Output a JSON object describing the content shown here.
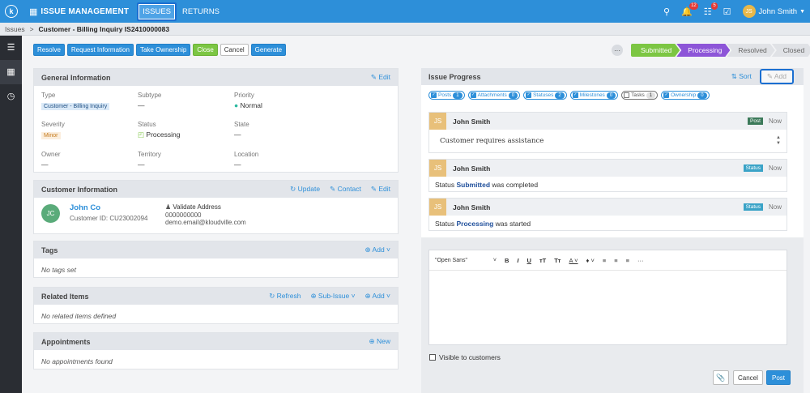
{
  "topnav": {
    "logo": "k",
    "app_title": "ISSUE MANAGEMENT",
    "tabs": [
      {
        "label": "ISSUES"
      },
      {
        "label": "RETURNS"
      }
    ],
    "notif_count": "12",
    "tasks_count": "5",
    "user_initials": "JS",
    "user_name": "John Smith"
  },
  "breadcrumb": {
    "root": "Issues",
    "current": "Customer - Billing Inquiry IS2410000083"
  },
  "toolbar": {
    "resolve": "Resolve",
    "request_info": "Request Information",
    "take_ownership": "Take Ownership",
    "close": "Close",
    "cancel": "Cancel",
    "generate": "Generate"
  },
  "stages": [
    {
      "label": "Submitted"
    },
    {
      "label": "Processing"
    },
    {
      "label": "Resolved"
    },
    {
      "label": "Closed"
    }
  ],
  "general": {
    "title": "General Information",
    "edit": "Edit",
    "type_label": "Type",
    "type_value": "Customer - Billing Inquiry",
    "subtype_label": "Subtype",
    "subtype_value": "—",
    "priority_label": "Priority",
    "priority_value": "Normal",
    "severity_label": "Severity",
    "severity_value": "Minor",
    "status_label": "Status",
    "status_value": "Processing",
    "state_label": "State",
    "state_value": "—",
    "owner_label": "Owner",
    "owner_value": "—",
    "territory_label": "Territory",
    "territory_value": "—",
    "location_label": "Location",
    "location_value": "—"
  },
  "customer": {
    "title": "Customer Information",
    "update": "Update",
    "contact": "Contact",
    "edit": "Edit",
    "initials": "JC",
    "name": "John Co",
    "customer_id": "Customer ID: CU23002094",
    "validate": "Validate Address",
    "phone": "0000000000",
    "email": "demo.email@kloudville.com"
  },
  "tags": {
    "title": "Tags",
    "add": "Add",
    "empty": "No tags set"
  },
  "related": {
    "title": "Related Items",
    "refresh": "Refresh",
    "sub_issue": "Sub-Issue",
    "add": "Add",
    "empty": "No related items defined"
  },
  "appointments": {
    "title": "Appointments",
    "new": "New",
    "empty": "No appointments found"
  },
  "progress": {
    "title": "Issue Progress",
    "sort": "Sort",
    "add": "Add",
    "filters": [
      {
        "label": "Posts",
        "count": "1",
        "checked": true
      },
      {
        "label": "Attachments",
        "count": "0",
        "checked": true
      },
      {
        "label": "Statuses",
        "count": "2",
        "checked": true
      },
      {
        "label": "Milestones",
        "count": "0",
        "checked": true
      },
      {
        "label": "Tasks",
        "count": "1",
        "checked": false
      },
      {
        "label": "Ownership",
        "count": "0",
        "checked": true
      }
    ],
    "entries": [
      {
        "initials": "JS",
        "name": "John Smith",
        "type": "Post",
        "time": "Now",
        "text": "Customer requires assistance"
      },
      {
        "initials": "JS",
        "name": "John Smith",
        "type": "Status",
        "time": "Now",
        "pre": "Status ",
        "highlight": "Submitted",
        "post": " was completed"
      },
      {
        "initials": "JS",
        "name": "John Smith",
        "type": "Status",
        "time": "Now",
        "pre": "Status ",
        "highlight": "Processing",
        "post": " was started"
      }
    ]
  },
  "editor": {
    "font": "\"Open Sans\"",
    "visible_label": "Visible to customers",
    "cancel": "Cancel",
    "post": "Post"
  },
  "colors": {
    "primary": "#2d8fd9",
    "green": "#7cc643",
    "purple": "#8d55d8",
    "post_tag": "#3c7a5a",
    "status_tag": "#3aa3c7"
  }
}
